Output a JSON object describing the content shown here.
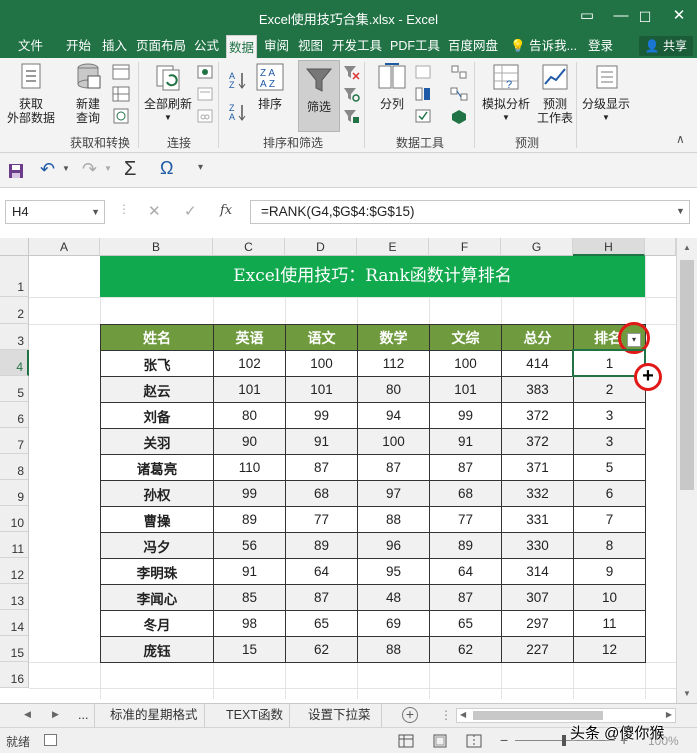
{
  "window": {
    "title": "Excel使用技巧合集.xlsx - Excel",
    "minimize": "—",
    "restore": "☐",
    "close": "✕"
  },
  "tabs": [
    "文件",
    "开始",
    "插入",
    "页面布局",
    "公式",
    "数据",
    "审阅",
    "视图",
    "开发工具",
    "PDF工具",
    "百度网盘"
  ],
  "active_tab": "数据",
  "tell_me": "告诉我...",
  "login": "登录",
  "share": "共享",
  "ribbon": {
    "get_external": "获取\n外部数据",
    "new_query": "新建\n查询",
    "group_get_transform": "获取和转换",
    "refresh_all": "全部刷新",
    "group_connections": "连接",
    "sort": "排序",
    "filter": "筛选",
    "group_sort_filter": "排序和筛选",
    "split": "分列",
    "group_data_tools": "数据工具",
    "what_if": "模拟分析",
    "forecast_sheet": "预测\n工作表",
    "group_forecast": "预测",
    "outline": "分级显示"
  },
  "qat": {
    "save_icon": "save-icon",
    "undo_icon": "undo-icon",
    "redo_icon": "redo-icon",
    "sigma": "Σ",
    "omega": "Ω"
  },
  "formula_bar": {
    "name_box": "H4",
    "fx": "fx",
    "formula": "=RANK(G4,$G$4:$G$15)"
  },
  "columns": [
    "A",
    "B",
    "C",
    "D",
    "E",
    "F",
    "G",
    "H"
  ],
  "rows": [
    "1",
    "2",
    "3",
    "4",
    "5",
    "6",
    "7",
    "8",
    "9",
    "10",
    "11",
    "12",
    "13",
    "14",
    "15",
    "16"
  ],
  "banner": "Excel使用技巧：Rank函数计算排名",
  "table": {
    "headers": [
      "姓名",
      "英语",
      "语文",
      "数学",
      "文综",
      "总分",
      "排名"
    ],
    "rows": [
      [
        "张飞",
        "102",
        "100",
        "112",
        "100",
        "414",
        "1"
      ],
      [
        "赵云",
        "101",
        "101",
        "80",
        "101",
        "383",
        "2"
      ],
      [
        "刘备",
        "80",
        "99",
        "94",
        "99",
        "372",
        "3"
      ],
      [
        "关羽",
        "90",
        "91",
        "100",
        "91",
        "372",
        "3"
      ],
      [
        "诸葛亮",
        "110",
        "87",
        "87",
        "87",
        "371",
        "5"
      ],
      [
        "孙权",
        "99",
        "68",
        "97",
        "68",
        "332",
        "6"
      ],
      [
        "曹操",
        "89",
        "77",
        "88",
        "77",
        "331",
        "7"
      ],
      [
        "冯夕",
        "56",
        "89",
        "96",
        "89",
        "330",
        "8"
      ],
      [
        "李明珠",
        "91",
        "64",
        "95",
        "64",
        "314",
        "9"
      ],
      [
        "李闻心",
        "85",
        "87",
        "48",
        "87",
        "307",
        "10"
      ],
      [
        "冬月",
        "98",
        "65",
        "69",
        "65",
        "297",
        "11"
      ],
      [
        "庞钰",
        "15",
        "62",
        "88",
        "62",
        "227",
        "12"
      ]
    ]
  },
  "sheet_tabs": [
    "...",
    "标准的星期格式",
    "TEXT函数",
    "设置下拉菜"
  ],
  "status": {
    "ready": "就绪",
    "zoom": "100%",
    "watermark": "头条 @傻你猴"
  }
}
